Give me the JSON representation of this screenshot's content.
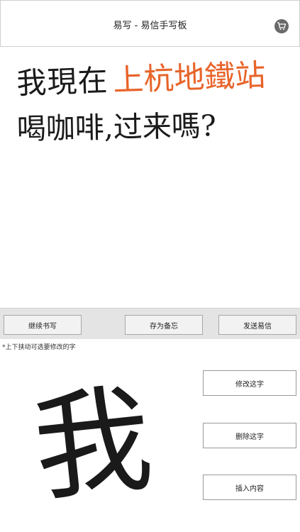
{
  "header": {
    "title": "易写 - 易信手写板",
    "cart_icon": "shopping-cart-icon"
  },
  "canvas": {
    "line1_black": "我現在",
    "line1_orange": "上杭地鐵站",
    "line2": "喝咖啡,过来嗎?",
    "ink_color": "#1a1a1a",
    "accent_color": "#e8642a"
  },
  "toolbar": {
    "continue_label": "继续书写",
    "save_memo_label": "存为备忘",
    "send_label": "发送易信"
  },
  "editor": {
    "hint": "*上下挟动可选要修改的字",
    "selected_char": "我",
    "modify_label": "修改这字",
    "delete_label": "删除这字",
    "insert_label": "插入内容"
  }
}
